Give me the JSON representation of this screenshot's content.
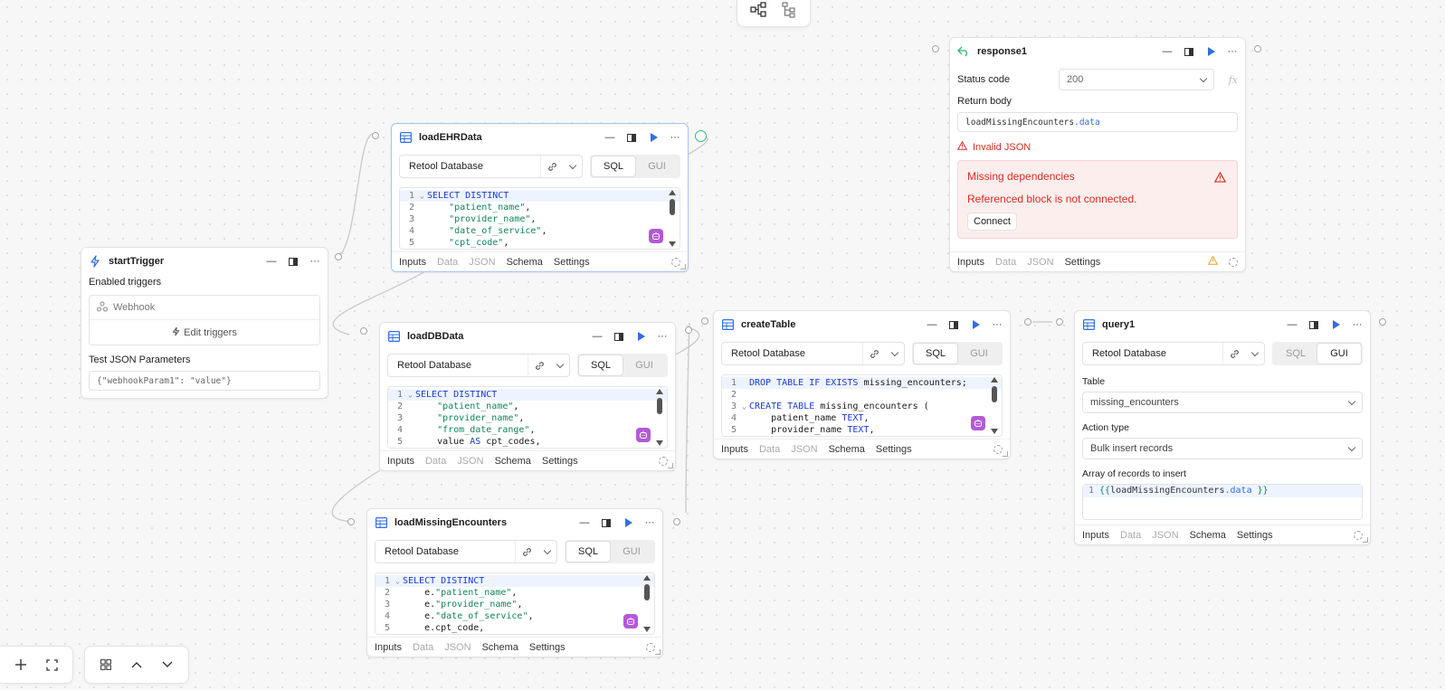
{
  "top_toolbar": {
    "icons": [
      "graph-layout-icon",
      "tree-layout-icon"
    ]
  },
  "bottom_toolbar": {
    "left_icons": [
      "plus-icon",
      "fit-view-icon"
    ],
    "right_icons": [
      "grid-icon",
      "chevron-up-icon",
      "chevron-down-icon"
    ]
  },
  "tabs": {
    "inputs": "Inputs",
    "data": "Data",
    "json": "JSON",
    "schema": "Schema",
    "settings": "Settings"
  },
  "seg": {
    "sql": "SQL",
    "gui": "GUI"
  },
  "startTrigger": {
    "title": "startTrigger",
    "enabled_label": "Enabled triggers",
    "webhook": "Webhook",
    "edit_triggers": "Edit triggers",
    "test_params_label": "Test JSON Parameters",
    "test_params_value": "{\"webhookParam1\": \"value\"}"
  },
  "loadEHRData": {
    "title": "loadEHRData",
    "resource": "Retool Database",
    "code": [
      {
        "n": "1",
        "fold": "⌄",
        "parts": [
          [
            "kw",
            "SELECT DISTINCT"
          ]
        ]
      },
      {
        "n": "2",
        "fold": "",
        "parts": [
          [
            "",
            "    "
          ],
          [
            "str",
            "\"patient_name\""
          ],
          [
            "",
            ","
          ]
        ]
      },
      {
        "n": "3",
        "fold": "",
        "parts": [
          [
            "",
            "    "
          ],
          [
            "str",
            "\"provider_name\""
          ],
          [
            "",
            ","
          ]
        ]
      },
      {
        "n": "4",
        "fold": "",
        "parts": [
          [
            "",
            "    "
          ],
          [
            "str",
            "\"date_of_service\""
          ],
          [
            "",
            ","
          ]
        ]
      },
      {
        "n": "5",
        "fold": "",
        "parts": [
          [
            "",
            "    "
          ],
          [
            "str",
            "\"cpt_code\""
          ],
          [
            "",
            ","
          ]
        ]
      }
    ]
  },
  "loadDBData": {
    "title": "loadDBData",
    "resource": "Retool Database",
    "code": [
      {
        "n": "1",
        "fold": "⌄",
        "parts": [
          [
            "kw",
            "SELECT DISTINCT"
          ]
        ]
      },
      {
        "n": "2",
        "fold": "",
        "parts": [
          [
            "",
            "    "
          ],
          [
            "str",
            "\"patient_name\""
          ],
          [
            "",
            ","
          ]
        ]
      },
      {
        "n": "3",
        "fold": "",
        "parts": [
          [
            "",
            "    "
          ],
          [
            "str",
            "\"provider_name\""
          ],
          [
            "",
            ","
          ]
        ]
      },
      {
        "n": "4",
        "fold": "",
        "parts": [
          [
            "",
            "    "
          ],
          [
            "str",
            "\"from_date_range\""
          ],
          [
            "",
            ","
          ]
        ]
      },
      {
        "n": "5",
        "fold": "",
        "parts": [
          [
            "",
            "    value "
          ],
          [
            "kw",
            "AS"
          ],
          [
            "",
            " cpt_codes,"
          ]
        ]
      }
    ]
  },
  "loadMissingEncounters": {
    "title": "loadMissingEncounters",
    "resource": "Retool Database",
    "code": [
      {
        "n": "1",
        "fold": "⌄",
        "parts": [
          [
            "kw",
            "SELECT DISTINCT"
          ]
        ]
      },
      {
        "n": "2",
        "fold": "",
        "parts": [
          [
            "",
            "    e."
          ],
          [
            "str",
            "\"patient_name\""
          ],
          [
            "",
            ","
          ]
        ]
      },
      {
        "n": "3",
        "fold": "",
        "parts": [
          [
            "",
            "    e."
          ],
          [
            "str",
            "\"provider_name\""
          ],
          [
            "",
            ","
          ]
        ]
      },
      {
        "n": "4",
        "fold": "",
        "parts": [
          [
            "",
            "    e."
          ],
          [
            "str",
            "\"date_of_service\""
          ],
          [
            "",
            ","
          ]
        ]
      },
      {
        "n": "5",
        "fold": "",
        "parts": [
          [
            "",
            "    e.cpt_code,"
          ]
        ]
      }
    ]
  },
  "createTable": {
    "title": "createTable",
    "resource": "Retool Database",
    "code": [
      {
        "n": "1",
        "fold": "",
        "parts": [
          [
            "kw",
            "DROP TABLE IF EXISTS"
          ],
          [
            "",
            " missing_encounters;"
          ]
        ]
      },
      {
        "n": "2",
        "fold": "",
        "parts": []
      },
      {
        "n": "3",
        "fold": "⌄",
        "parts": [
          [
            "kw",
            "CREATE TABLE"
          ],
          [
            "",
            " missing_encounters ("
          ]
        ]
      },
      {
        "n": "4",
        "fold": "",
        "parts": [
          [
            "",
            "    patient_name "
          ],
          [
            "kw",
            "TEXT"
          ],
          [
            "",
            ","
          ]
        ]
      },
      {
        "n": "5",
        "fold": "",
        "parts": [
          [
            "",
            "    provider_name "
          ],
          [
            "kw",
            "TEXT"
          ],
          [
            "",
            ","
          ]
        ]
      }
    ]
  },
  "response1": {
    "title": "response1",
    "status_label": "Status code",
    "status_value": "200",
    "fx": "fx",
    "return_label": "Return body",
    "return_value_a": "loadMissingEncounters",
    "return_value_b": ".data",
    "invalid": "Invalid JSON",
    "missing_title": "Missing dependencies",
    "missing_text": "Referenced block is not connected.",
    "connect": "Connect"
  },
  "query1": {
    "title": "query1",
    "resource": "Retool Database",
    "table_label": "Table",
    "table_value": "missing_encounters",
    "action_label": "Action type",
    "action_value": "Bulk insert records",
    "records_label": "Array of records to insert",
    "records_line": "1",
    "records_a": "{{ ",
    "records_b": "loadMissingEncounters",
    "records_c": ".data",
    "records_d": " }}"
  },
  "colors": {
    "accent": "#2f6fe4",
    "keyword": "#1a3bd0",
    "string": "#12845c",
    "error": "#d92d20",
    "ai_badge": "#b35ad6",
    "warning": "#e8a21a"
  }
}
